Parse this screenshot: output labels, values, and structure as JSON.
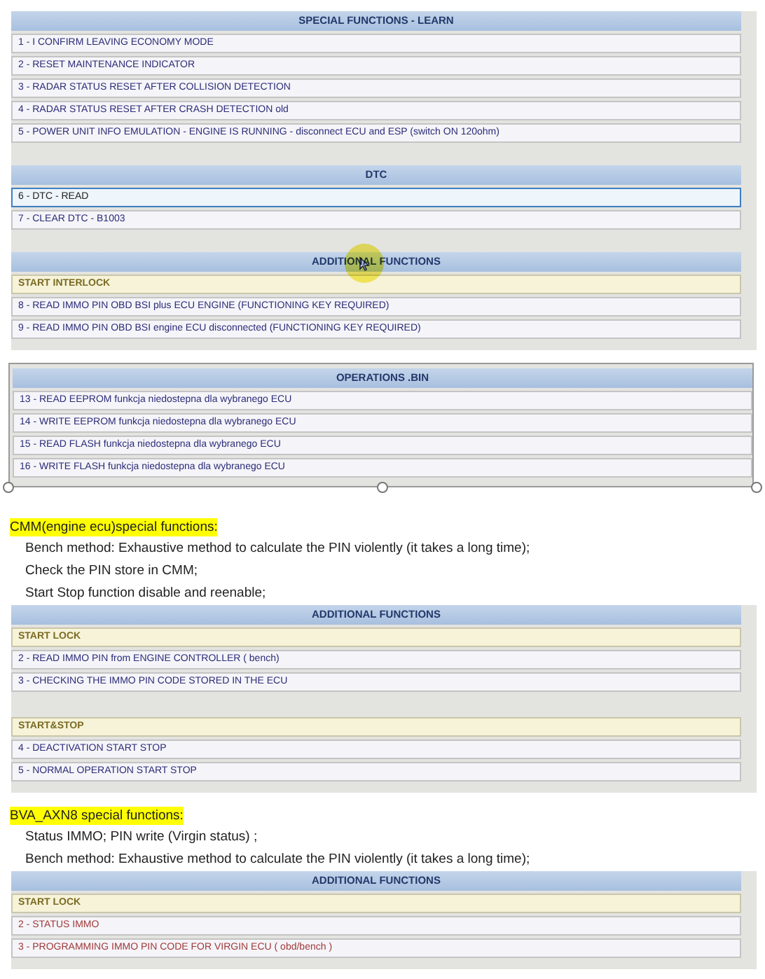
{
  "blocks": [
    {
      "kind": "panel",
      "selected": false,
      "sections": [
        {
          "title": "SPECIAL FUNCTIONS - LEARN",
          "rows": [
            {
              "kind": "item",
              "label": "1 - I CONFIRM LEAVING ECONOMY MODE",
              "selected": false,
              "disabled": false
            },
            {
              "kind": "item",
              "label": "2 - RESET MAINTENANCE INDICATOR",
              "selected": false,
              "disabled": false
            },
            {
              "kind": "item",
              "label": "3 -  RADAR STATUS RESET AFTER COLLISION DETECTION",
              "selected": false,
              "disabled": false
            },
            {
              "kind": "item",
              "label": "4 -  RADAR STATUS RESET AFTER CRASH DETECTION old",
              "selected": false,
              "disabled": false
            },
            {
              "kind": "item",
              "label": "5 - POWER UNIT INFO EMULATION - ENGINE IS RUNNING - disconnect ECU and ESP (switch ON 120ohm)",
              "selected": false,
              "disabled": false
            }
          ]
        },
        {
          "title": "DTC",
          "rows": [
            {
              "kind": "item",
              "label": "6 - DTC - READ",
              "selected": true,
              "disabled": false
            },
            {
              "kind": "item",
              "label": "7 - CLEAR DTC - B1003",
              "selected": false,
              "disabled": false
            }
          ]
        },
        {
          "title": "ADDITIONAL FUNCTIONS",
          "cursor": true,
          "rows": [
            {
              "kind": "group",
              "label": "START INTERLOCK"
            },
            {
              "kind": "item",
              "label": "8 - READ IMMO PIN OBD BSI plus ECU ENGINE (FUNCTIONING KEY REQUIRED)",
              "selected": false,
              "disabled": false
            },
            {
              "kind": "item",
              "label": "9 - READ IMMO PIN OBD BSI engine ECU disconnected (FUNCTIONING KEY REQUIRED)",
              "selected": false,
              "disabled": false
            }
          ]
        }
      ]
    },
    {
      "kind": "panel",
      "selected": true,
      "sections": [
        {
          "title": "OPERATIONS .BIN",
          "rows": [
            {
              "kind": "item",
              "label": "13 - READ EEPROM  funkcja niedostepna dla wybranego ECU",
              "selected": false,
              "disabled": false
            },
            {
              "kind": "item",
              "label": "14 - WRITE EEPROM  funkcja niedostepna dla wybranego ECU",
              "selected": false,
              "disabled": false
            },
            {
              "kind": "item",
              "label": "15 - READ FLASH  funkcja niedostepna dla wybranego ECU",
              "selected": false,
              "disabled": false
            },
            {
              "kind": "item",
              "label": "16 - WRITE FLASH  funkcja niedostepna dla wybranego ECU",
              "selected": false,
              "disabled": false
            }
          ]
        }
      ]
    },
    {
      "kind": "heading",
      "text": "CMM(engine ecu)special functions:"
    },
    {
      "kind": "line",
      "text": "Bench method: Exhaustive method to calculate the PIN violently (it takes a long time);"
    },
    {
      "kind": "line",
      "text": "Check the PIN store in CMM;"
    },
    {
      "kind": "line",
      "text": "Start Stop function disable and reenable;"
    },
    {
      "kind": "panel",
      "selected": false,
      "sections": [
        {
          "title": "ADDITIONAL FUNCTIONS",
          "rows": [
            {
              "kind": "group",
              "label": "START LOCK"
            },
            {
              "kind": "item",
              "label": "2 - READ IMMO PIN from ENGINE CONTROLLER ( bench)",
              "selected": false,
              "disabled": false
            },
            {
              "kind": "item",
              "label": "3 - CHECKING THE IMMO PIN CODE STORED IN THE ECU",
              "selected": false,
              "disabled": false
            },
            {
              "kind": "spacer"
            },
            {
              "kind": "group",
              "label": "START&STOP"
            },
            {
              "kind": "item",
              "label": "4 -  DEACTIVATION START  STOP",
              "selected": false,
              "disabled": false
            },
            {
              "kind": "item",
              "label": "5 -  NORMAL OPERATION START  STOP",
              "selected": false,
              "disabled": false
            }
          ]
        }
      ]
    },
    {
      "kind": "heading",
      "text": "BVA_AXN8 special functions:"
    },
    {
      "kind": "line",
      "text": "Status IMMO;   PIN write  (Virgin status) ;"
    },
    {
      "kind": "line",
      "text": "Bench method: Exhaustive method to calculate the PIN violently (it takes a long time);"
    },
    {
      "kind": "panel",
      "selected": false,
      "sections": [
        {
          "title": "ADDITIONAL FUNCTIONS",
          "rows": [
            {
              "kind": "group",
              "label": "START LOCK"
            },
            {
              "kind": "item",
              "label": "2 - STATUS IMMO",
              "selected": false,
              "disabled": true
            },
            {
              "kind": "item",
              "label": "3 - PROGRAMMING IMMO PIN CODE FOR VIRGIN ECU ( obd/bench )",
              "selected": false,
              "disabled": true
            }
          ]
        }
      ]
    }
  ]
}
